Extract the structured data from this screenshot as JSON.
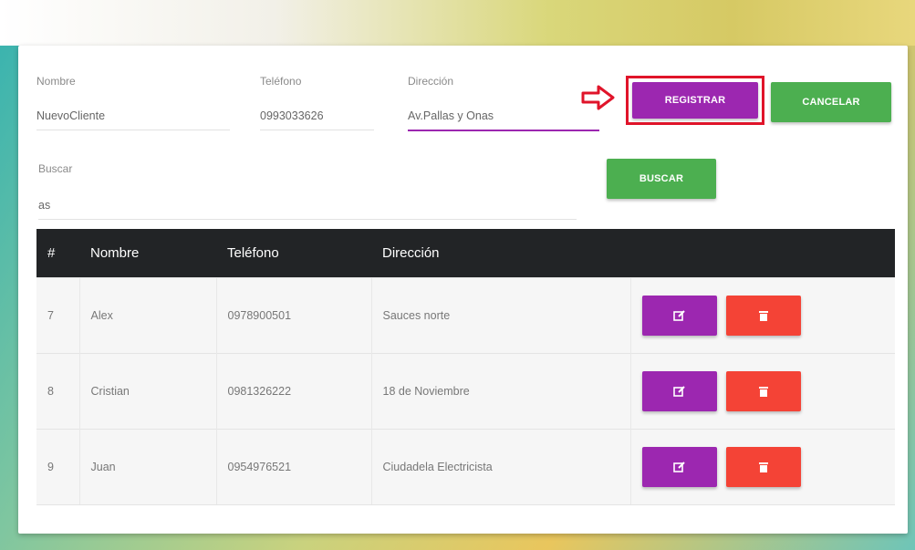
{
  "form": {
    "nombre": {
      "label": "Nombre",
      "value": "NuevoCliente"
    },
    "telefono": {
      "label": "Teléfono",
      "value": "0993033626"
    },
    "direccion": {
      "label": "Dirección",
      "value": "Av.Pallas y Onas"
    },
    "register_label": "REGISTRAR",
    "cancel_label": "CANCELAR"
  },
  "search": {
    "label": "Buscar",
    "value": "as",
    "button_label": "BUSCAR"
  },
  "table": {
    "headers": [
      "#",
      "Nombre",
      "Teléfono",
      "Dirección",
      ""
    ],
    "rows": [
      {
        "id": "7",
        "nombre": "Alex",
        "telefono": "0978900501",
        "direccion": "Sauces norte"
      },
      {
        "id": "8",
        "nombre": "Cristian",
        "telefono": "0981326222",
        "direccion": "18 de Noviembre"
      },
      {
        "id": "9",
        "nombre": "Juan",
        "telefono": "0954976521",
        "direccion": "Ciudadela Electricista"
      }
    ]
  },
  "icons": {
    "edit": "edit-icon",
    "delete": "trash-icon",
    "annotation": "arrow-right-icon"
  },
  "colors": {
    "purple": "#9c27b0",
    "green": "#4caf50",
    "red": "#f44336",
    "annotation": "#e0142a",
    "header": "#222426"
  }
}
